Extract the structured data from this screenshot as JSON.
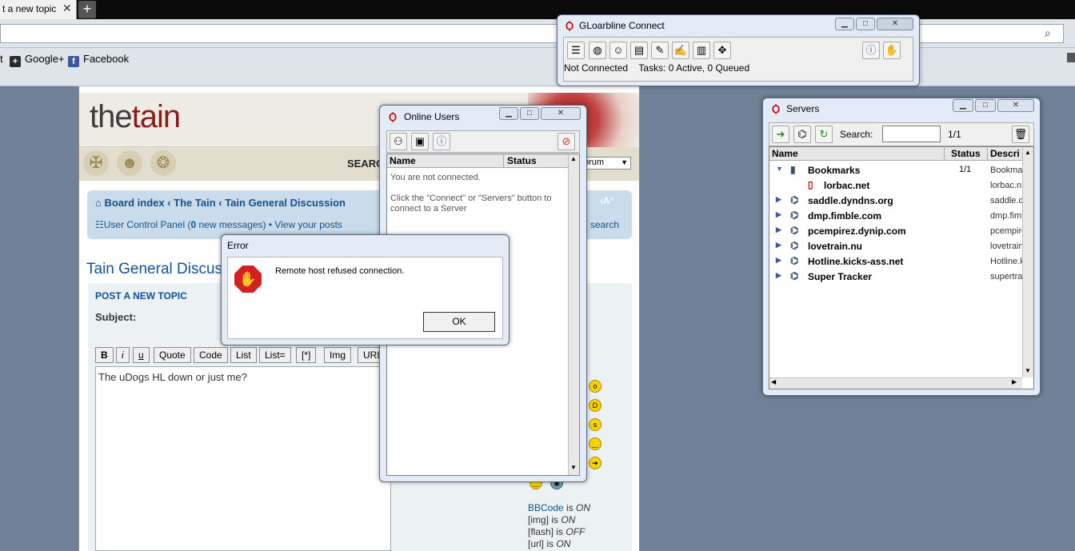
{
  "browser": {
    "tab_title": "t a new topic",
    "tab_close": "✕",
    "new_tab": "+",
    "bookmarks": [
      {
        "label": "t",
        "icon": "none"
      },
      {
        "label": "Google+",
        "icon": "google-plus-icon"
      },
      {
        "label": "Facebook",
        "icon": "facebook-icon"
      }
    ]
  },
  "forum": {
    "logo_part1": "the",
    "logo_part2": "tain",
    "search_label": "SEARC",
    "forum_select": "orum",
    "breadcrumb": [
      "Board index",
      "The Tain",
      "Tain General Discussion"
    ],
    "ucp_prefix": "User Control Panel (",
    "ucp_count": "0",
    "ucp_suffix": " new messages)",
    "view_posts": "View your posts",
    "adv_search": "d search",
    "font_size": "‹A^",
    "title": "Tain General Discus",
    "post_heading": "POST A NEW TOPIC",
    "subject_label": "Subject:",
    "bbcode_buttons": [
      "B",
      "i",
      "u",
      "Quote",
      "Code",
      "List",
      "List=",
      "[*]",
      "Img",
      "URL"
    ],
    "message": "The uDogs HL down or just me?",
    "bbinfo": [
      {
        "label": "BBCode",
        "state": "ON"
      },
      {
        "label": "[img]",
        "state": "ON"
      },
      {
        "label": "[flash]",
        "state": "OFF"
      },
      {
        "label": "[url]",
        "state": "ON"
      }
    ]
  },
  "gloarbline": {
    "title": "GLoarbline Connect",
    "status": "Not Connected",
    "tasks": "Tasks: 0 Active, 0 Queued"
  },
  "online_users": {
    "title": "Online Users",
    "col_name": "Name",
    "col_status": "Status",
    "msg1": "You are not connected.",
    "msg2": "Click the \"Connect\" or \"Servers\" button to connect to a Server"
  },
  "error_dialog": {
    "title": "Error",
    "message": "Remote host refused connection.",
    "ok": "OK"
  },
  "servers": {
    "title": "Servers",
    "search_label": "Search:",
    "count": "1/1",
    "col_name": "Name",
    "col_status": "Status",
    "col_desc": "Descri",
    "rows": [
      {
        "name": "Bookmarks",
        "status": "1/1",
        "desc": "Bookma",
        "level": 0,
        "expanded": true,
        "icon": "book-icon"
      },
      {
        "name": "lorbac.net",
        "status": "",
        "desc": "lorbac.n",
        "level": 1,
        "icon": "hotline-icon"
      },
      {
        "name": "saddle.dyndns.org",
        "status": "",
        "desc": "saddle.d",
        "level": 0,
        "icon": "network-icon"
      },
      {
        "name": "dmp.fimble.com",
        "status": "",
        "desc": "dmp.fimb",
        "level": 0,
        "icon": "network-icon"
      },
      {
        "name": "pcempirez.dynip.com",
        "status": "",
        "desc": "pcempire",
        "level": 0,
        "icon": "network-icon"
      },
      {
        "name": "lovetrain.nu",
        "status": "",
        "desc": "lovetrain",
        "level": 0,
        "icon": "network-icon"
      },
      {
        "name": "Hotline.kicks-ass.net",
        "status": "",
        "desc": "Hotline.k",
        "level": 0,
        "icon": "network-icon"
      },
      {
        "name": "Super Tracker",
        "status": "",
        "desc": "supertra",
        "level": 0,
        "icon": "network-icon"
      }
    ]
  }
}
